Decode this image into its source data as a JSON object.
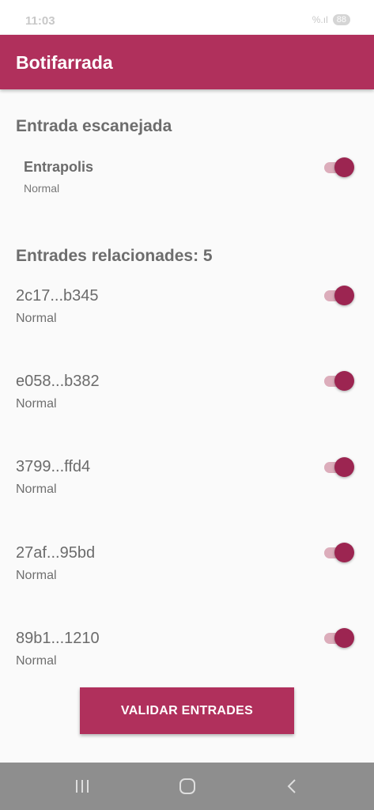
{
  "status_bar": {
    "time": "11:03",
    "signal": "%.ıl",
    "battery": "88"
  },
  "app_bar": {
    "title": "Botifarrada"
  },
  "scanned": {
    "heading": "Entrada escanejada",
    "entry": {
      "name": "Entrapolis",
      "type": "Normal",
      "enabled": true
    }
  },
  "related": {
    "heading": "Entrades relacionades: 5",
    "items": [
      {
        "code": "2c17...b345",
        "type": "Normal",
        "enabled": true
      },
      {
        "code": "e058...b382",
        "type": "Normal",
        "enabled": true
      },
      {
        "code": "3799...ffd4",
        "type": "Normal",
        "enabled": true
      },
      {
        "code": "27af...95bd",
        "type": "Normal",
        "enabled": true
      },
      {
        "code": "89b1...1210",
        "type": "Normal",
        "enabled": true
      }
    ]
  },
  "actions": {
    "validate_label": "VALIDAR ENTRADES"
  },
  "colors": {
    "primary": "#b0305c",
    "switch_thumb": "#9c2551",
    "switch_track": "#dcadbb",
    "nav_bar": "#8e8e8e"
  },
  "nav": {
    "icons": [
      "recent-apps-icon",
      "home-icon",
      "back-icon"
    ]
  }
}
